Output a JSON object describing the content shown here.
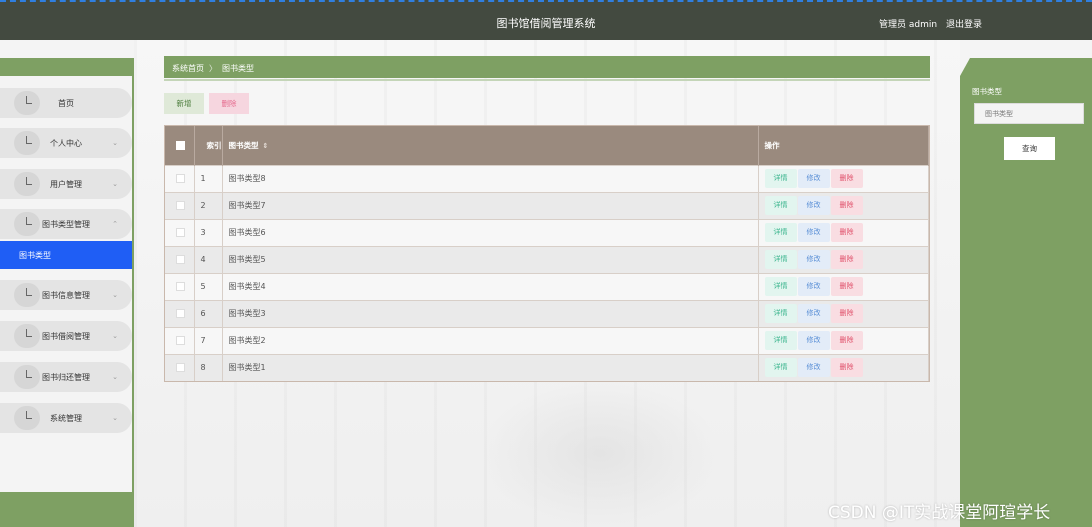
{
  "header": {
    "title": "图书馆借阅管理系统",
    "user": "管理员 admin",
    "logout": "退出登录"
  },
  "sidebar": {
    "items": [
      {
        "label": "首页",
        "has_arrow": false
      },
      {
        "label": "个人中心",
        "has_arrow": true,
        "arrow": "⌄"
      },
      {
        "label": "用户管理",
        "has_arrow": true,
        "arrow": "⌄"
      },
      {
        "label": "图书类型管理",
        "has_arrow": true,
        "arrow": "⌃"
      },
      {
        "label": "图书信息管理",
        "has_arrow": true,
        "arrow": "⌄"
      },
      {
        "label": "图书借阅管理",
        "has_arrow": true,
        "arrow": "⌄"
      },
      {
        "label": "图书归还管理",
        "has_arrow": true,
        "arrow": "⌄"
      },
      {
        "label": "系统管理",
        "has_arrow": true,
        "arrow": "⌄"
      }
    ],
    "active_sub": "图书类型"
  },
  "breadcrumb": {
    "home": "系统首页",
    "sep": "〉",
    "current": "图书类型"
  },
  "toolbar": {
    "add_label": "新增",
    "delete_label": "删除"
  },
  "table": {
    "headers": {
      "index": "索引",
      "type": "图书类型",
      "sort_icon": "⇕",
      "ops": "操作"
    },
    "ops_labels": {
      "detail": "详情",
      "edit": "修改",
      "delete": "删除"
    },
    "rows": [
      {
        "index": "1",
        "type": "图书类型8"
      },
      {
        "index": "2",
        "type": "图书类型7"
      },
      {
        "index": "3",
        "type": "图书类型6"
      },
      {
        "index": "4",
        "type": "图书类型5"
      },
      {
        "index": "5",
        "type": "图书类型4"
      },
      {
        "index": "6",
        "type": "图书类型3"
      },
      {
        "index": "7",
        "type": "图书类型2"
      },
      {
        "index": "8",
        "type": "图书类型1"
      }
    ]
  },
  "search": {
    "label": "图书类型",
    "placeholder": "图书类型",
    "button": "查询"
  },
  "watermark": "CSDN @IT实战课堂阿瑄学长",
  "colors": {
    "topbar": "#434a40",
    "accent_green": "#7ea063",
    "active_blue": "#1f5ef5",
    "table_header": "#9a8a7e"
  }
}
